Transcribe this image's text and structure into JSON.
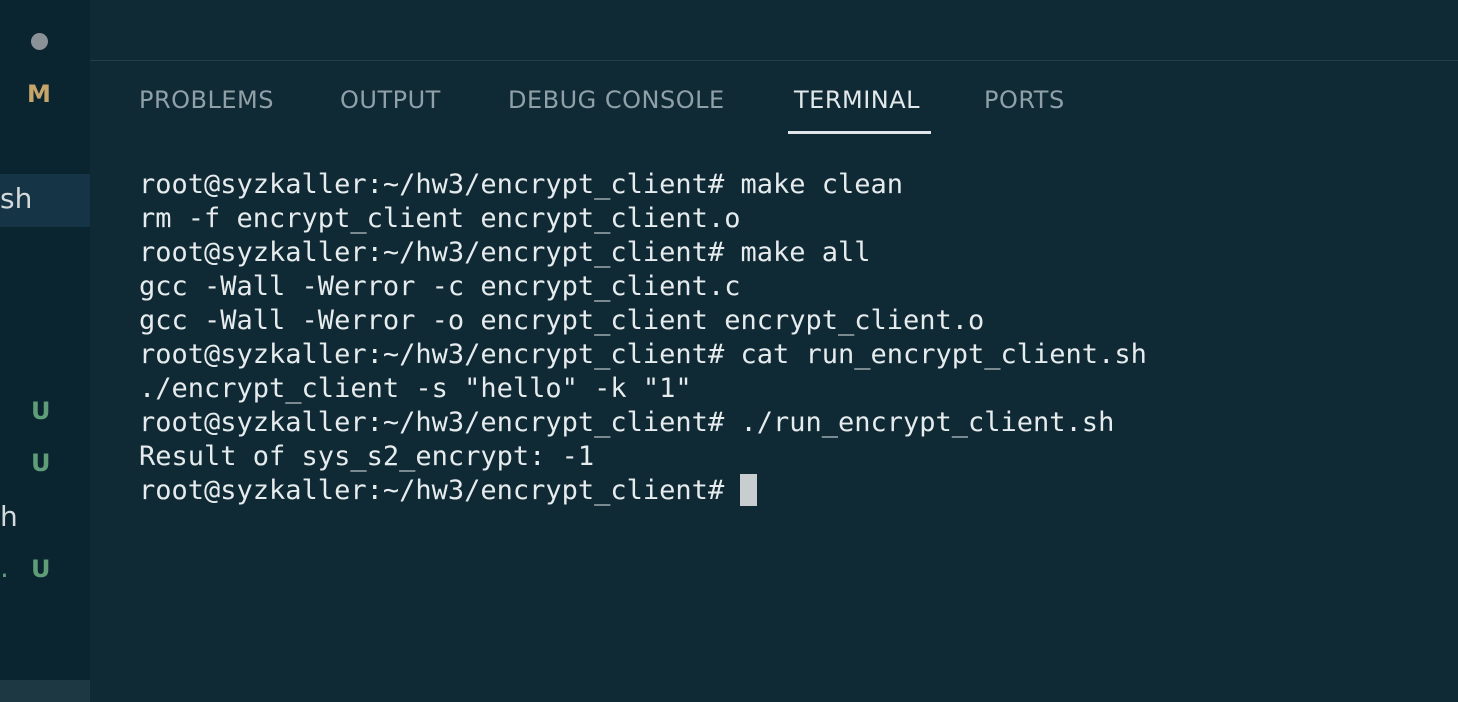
{
  "sidebar": {
    "badges": {
      "m": "M",
      "u1": "U",
      "u2": "U",
      "u3": "U"
    },
    "fragments": {
      "selected": "sh",
      "row2": "h",
      "row3": "."
    }
  },
  "panel": {
    "tabs": [
      {
        "label": "PROBLEMS"
      },
      {
        "label": "OUTPUT"
      },
      {
        "label": "DEBUG CONSOLE"
      },
      {
        "label": "TERMINAL"
      },
      {
        "label": "PORTS"
      }
    ],
    "active_tab": "TERMINAL"
  },
  "terminal": {
    "lines": [
      "root@syzkaller:~/hw3/encrypt_client# make clean",
      "rm -f encrypt_client encrypt_client.o",
      "root@syzkaller:~/hw3/encrypt_client# make all",
      "gcc -Wall -Werror -c encrypt_client.c",
      "gcc -Wall -Werror -o encrypt_client encrypt_client.o",
      "root@syzkaller:~/hw3/encrypt_client# cat run_encrypt_client.sh",
      "./encrypt_client -s \"hello\" -k \"1\"",
      "root@syzkaller:~/hw3/encrypt_client# ./run_encrypt_client.sh",
      "Result of sys_s2_encrypt: -1"
    ],
    "prompt": "root@syzkaller:~/hw3/encrypt_client# "
  },
  "colors": {
    "background": "#0f2a35",
    "sidebar": "#0a2430",
    "modified_badge": "#c6a56a",
    "untracked_badge": "#5f9c78"
  }
}
